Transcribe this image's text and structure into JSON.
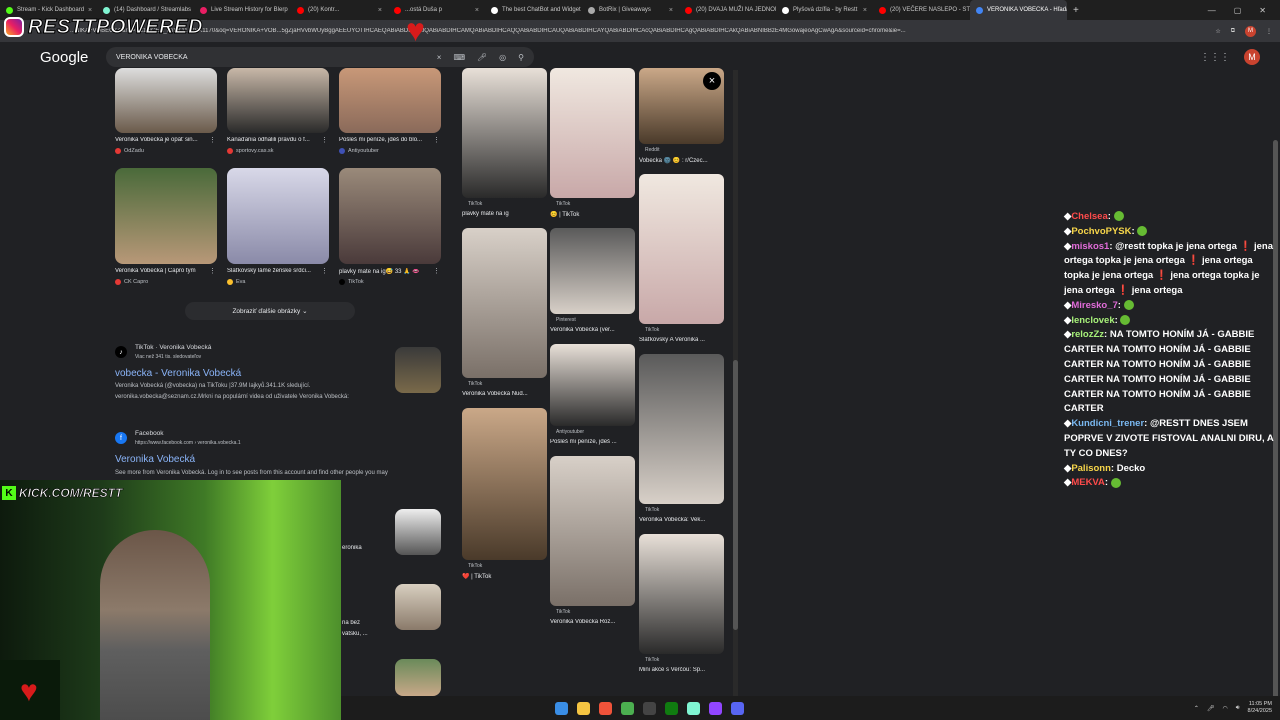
{
  "tabs": [
    {
      "label": "Stream - Kick Dashboard",
      "color": "#53fc18"
    },
    {
      "label": "(14) Dashboard / Streamlabs",
      "color": "#80f5d2"
    },
    {
      "label": "Live Stream History for Blerp",
      "color": "#e91e63"
    },
    {
      "label": "(20) Kontr...",
      "color": "#ff0000"
    },
    {
      "label": "...ostá Duša p",
      "color": "#ff0000"
    },
    {
      "label": "The best ChatBot and Widget",
      "color": "#ffffff"
    },
    {
      "label": "BotRix | Giveaways",
      "color": "#aaaaaa"
    },
    {
      "label": "(20) DVAJA MUŽI NA JEDNOM",
      "color": "#ff0000"
    },
    {
      "label": "Plyšová dzífia - by Restt",
      "color": "#ffffff"
    },
    {
      "label": "(20) VEČERE NASLEPO - STRI",
      "color": "#ff0000"
    },
    {
      "label": "VERONIKA VOBECKA - Hľadať",
      "color": "#4285f4",
      "active": true
    }
  ],
  "address": {
    "url": "...NIKA+VOBECKA&rlz=1C1GCEA_enSK1170SK1170&oq=VERONIKA+VOB...5gZjaHVvbWUyBggAEEUYOTIHCAEQABiABDIHCAIQABiABDIHCAMQABiABDIHCAQQABiABDIHCAUQABiABDIHCAYQABiABDIHCAcQABiABDIHCAgQABiABDIHCAkQABiABNIBBzE4MGowajeoAgCwAgA&sourceid=chrome&ie=...",
    "avatar": "M"
  },
  "google": {
    "logo": "Google",
    "query": "VERONIKA VOBECKA",
    "avatar": "M"
  },
  "left_images": [
    {
      "caption": "Veronika Vobecká je opäť sin...",
      "source": "OdZadu",
      "dot": "#e53935"
    },
    {
      "caption": "Kanaďania odhalili pravdu o f...",
      "source": "sportovy.cas.sk",
      "dot": "#e53935"
    },
    {
      "caption": "Pošleš mi peníze, jdeš do blo...",
      "source": "Antiyoutuber",
      "dot": "#3f51b5"
    },
    {
      "caption": "Veronika Vobecká | Capro tým",
      "source": "CK Capro",
      "dot": "#e53935"
    },
    {
      "caption": "Slaťkovský láme ženské srdci...",
      "source": "Eva",
      "dot": "#fbc02d"
    },
    {
      "caption": "plavky mate na ig😅 33 🙏 👄",
      "source": "TikTok",
      "dot": "#000000"
    }
  ],
  "show_more": "Zobraziť ďalšie obrázky",
  "results": [
    {
      "site": "TikTok · Veronika Vobecká",
      "url": "Viac než 341 tis. sledovateľov",
      "title": "vobecka - Veronika Vobecká",
      "snippet": "Veronika Vobecká (@vobecka) na TikToku |37.9M lajkyů.341.1K sledující. veronika.vobecka@seznam.cz.Mrkni na populární videa od uživatele Veronika Vobecká:"
    },
    {
      "site": "Facebook",
      "url": "https://www.facebook.com › veronika.vobecka.1",
      "title": "Veronika Vobecká",
      "snippet": "See more from Veronika Vobecká. Log in to see posts from this account and find other people you may"
    }
  ],
  "partial_results": [
    "eronika",
    "na bez",
    "vätsku, ..."
  ],
  "panel": {
    "col1": [
      {
        "source": "TikTok",
        "caption": "plavky mate na ig"
      },
      {
        "source": "TikTok",
        "caption": "Veronika Vobecká Nud..."
      },
      {
        "source": "TikTok",
        "caption": "❤️ | TikTok"
      }
    ],
    "col2": [
      {
        "source": "TikTok",
        "caption": "😊 | TikTok"
      },
      {
        "source": "Pinterest",
        "caption": "Veronika Vobecká (ver..."
      },
      {
        "source": "Antiyoutuber",
        "caption": "Pošleš mi peníze, jdeš ..."
      },
      {
        "source": "TikTok",
        "caption": "Veronika Vobecka Roz..."
      }
    ],
    "col3": [
      {
        "source": "Reddit",
        "caption": "Vobecka 🌚 😊 : r/Czec..."
      },
      {
        "source": "TikTok",
        "caption": "Slaťkovsky A Veronika ..."
      },
      {
        "source": "TikTok",
        "caption": "Veronika Vobecká: Vek..."
      },
      {
        "source": "TikTok",
        "caption": "Mini akce s Verčou: Sp..."
      }
    ],
    "close": "×"
  },
  "overlay": {
    "brand": "RESTTPOWERED",
    "kick": "KICK.COM/RESTT"
  },
  "chat": [
    {
      "user": "Chelsea",
      "text": "",
      "cls": "red"
    },
    {
      "user": "PochvoPYSK",
      "text": "",
      "cls": "yellow"
    },
    {
      "user": "miskos1",
      "text": "@restt topka je jena ortega ❗ jena ortega topka je jena ortega ❗ jena ortega topka je jena ortega ❗ jena ortega topka je jena ortega ❗ jena ortega",
      "cls": "pink"
    },
    {
      "user": "Miresko_7",
      "text": "",
      "cls": "pink"
    },
    {
      "user": "lenclovek",
      "text": "",
      "cls": ""
    },
    {
      "user": "relozZz",
      "text": "NA TOMTO HONÍM JÁ - GABBIE CARTER NA TOMTO HONÍM JÁ - GABBIE CARTER NA TOMTO HONÍM JÁ - GABBIE CARTER NA TOMTO HONÍM JÁ - GABBIE CARTER NA TOMTO HONÍM JÁ - GABBIE CARTER",
      "cls": ""
    },
    {
      "user": "Kundicni_trener",
      "text": "@RESTT DNES JSEM POPRVE V ZIVOTE FISTOVAL ANALNI DIRU, A TY CO DNES?",
      "cls": "blue"
    },
    {
      "user": "Palisonn",
      "text": "Decko",
      "cls": "yellow"
    },
    {
      "user": "MEKVA",
      "text": "",
      "cls": "red"
    }
  ],
  "clock": {
    "time": "11:05 PM",
    "date": "8/24/2025"
  }
}
